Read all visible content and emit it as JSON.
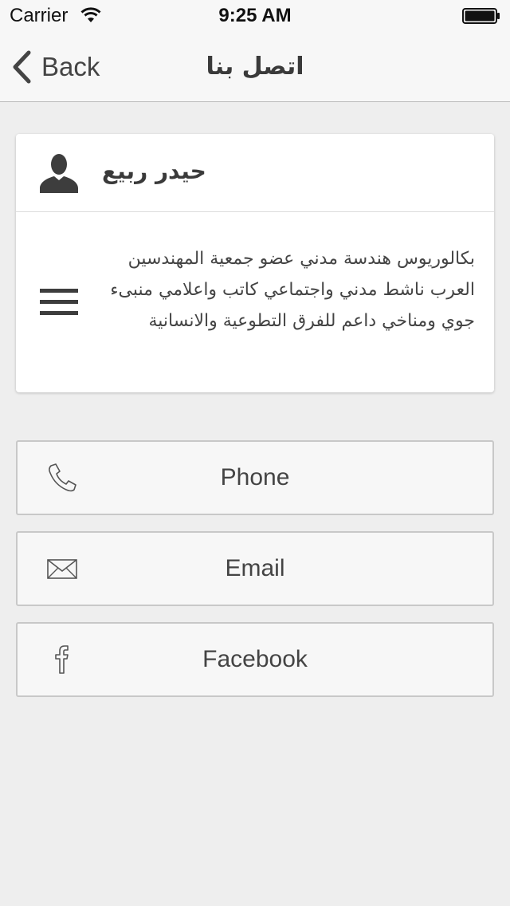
{
  "status_bar": {
    "carrier": "Carrier",
    "time": "9:25 AM"
  },
  "nav": {
    "back_label": "Back",
    "title": "اتصل بنا"
  },
  "profile": {
    "name": "حيدر ربيع",
    "bio": "بكالوريوس هندسة مدني عضو جمعية المهندسين العرب ناشط مدني واجتماعي كاتب واعلامي منبىء جوي ومناخي داعم للفرق التطوعية والانسانية"
  },
  "contacts": {
    "phone_label": "Phone",
    "email_label": "Email",
    "facebook_label": "Facebook"
  },
  "icons": {
    "wifi": "wifi-icon",
    "battery": "battery-icon",
    "back": "chevron-left-icon",
    "person": "person-icon",
    "menu": "menu-icon",
    "phone": "phone-icon",
    "email": "envelope-icon",
    "facebook": "facebook-icon"
  },
  "colors": {
    "background": "#eeeeee",
    "bar": "#f7f7f7",
    "card": "#ffffff",
    "text": "#444444"
  }
}
